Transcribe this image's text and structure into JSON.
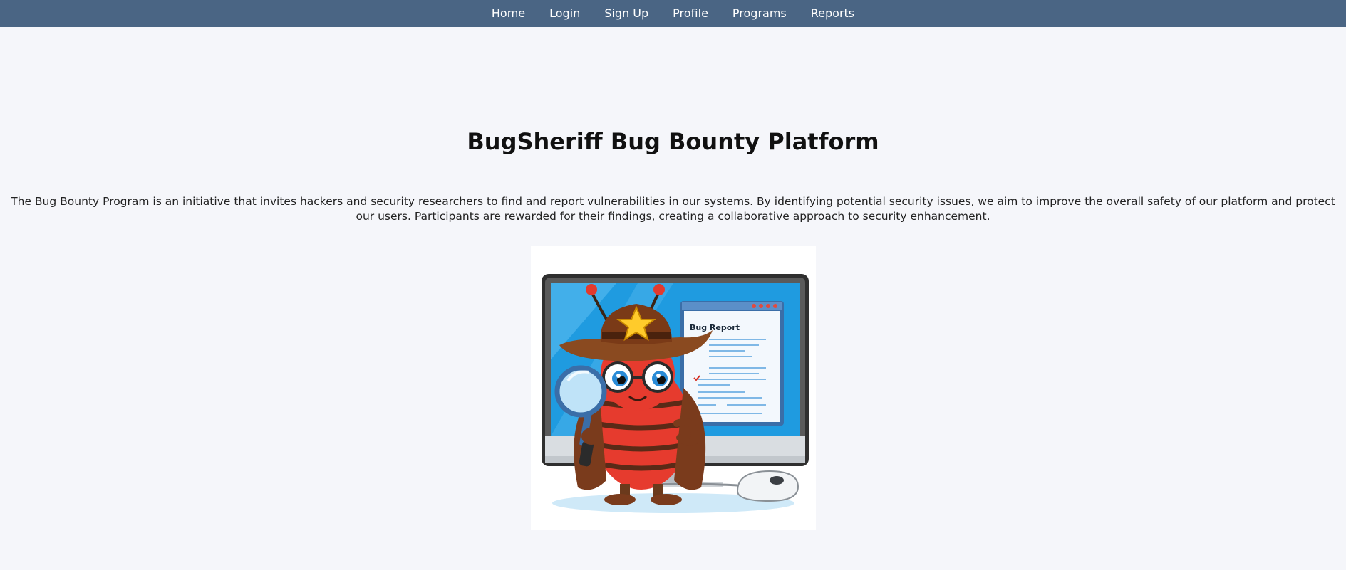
{
  "nav": {
    "items": [
      {
        "label": "Home"
      },
      {
        "label": "Login"
      },
      {
        "label": "Sign Up"
      },
      {
        "label": "Profile"
      },
      {
        "label": "Programs"
      },
      {
        "label": "Reports"
      }
    ]
  },
  "hero": {
    "title": "BugSheriff Bug Bounty Platform",
    "description": "The Bug Bounty Program is an initiative that invites hackers and security researchers to find and report vulnerabilities in our systems. By identifying potential security issues, we aim to improve the overall safety of our platform and protect our users. Participants are rewarded for their findings, creating a collaborative approach to security enhancement."
  },
  "illustration": {
    "report_heading": "Bug Report"
  },
  "colors": {
    "navbar": "#4a6584",
    "background": "#f5f6fa"
  }
}
